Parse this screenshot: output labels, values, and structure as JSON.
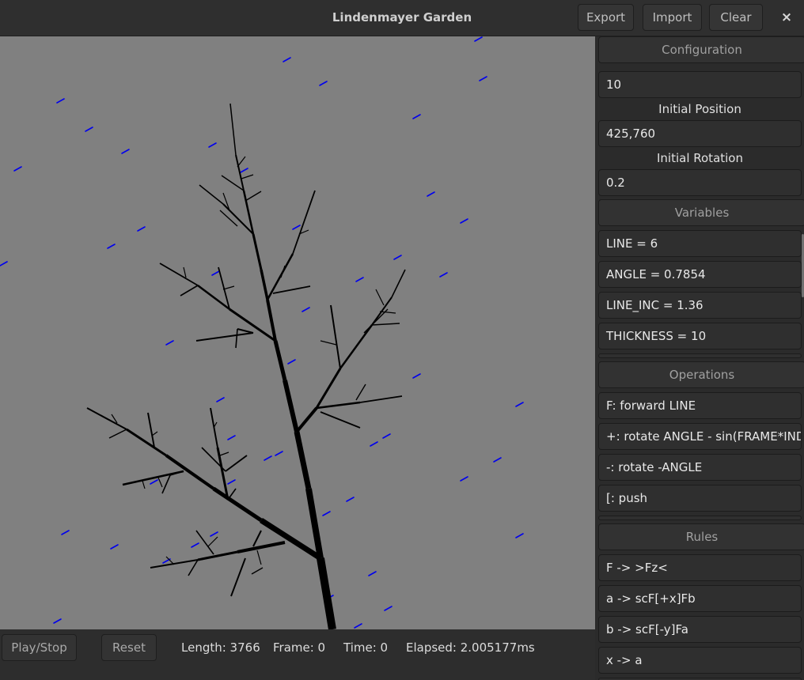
{
  "window": {
    "title": "Lindenmayer Garden",
    "buttons": {
      "export": "Export",
      "import": "Import",
      "clear": "Clear",
      "close": "×"
    }
  },
  "toolbar": {
    "play_stop": "Play/Stop",
    "reset": "Reset",
    "length": "Length: 3766",
    "frame": "Frame: 0",
    "time": "Time: 0",
    "elapsed": "Elapsed: 2.005177ms"
  },
  "panel": {
    "configuration": {
      "header": "Configuration",
      "iterations": "10",
      "initial_position_label": "Initial Position",
      "initial_position": "425,760",
      "initial_rotation_label": "Initial Rotation",
      "initial_rotation": "0.2"
    },
    "variables": {
      "header": "Variables",
      "items": [
        "LINE = 6",
        "ANGLE = 0.7854",
        "LINE_INC = 1.36",
        "THICKNESS = 10"
      ]
    },
    "operations": {
      "header": "Operations",
      "items": [
        "F: forward LINE",
        "+: rotate ANGLE - sin(FRAME*INDEX",
        "-: rotate -ANGLE",
        "[: push"
      ]
    },
    "rules": {
      "header": "Rules",
      "items": [
        "F -> >Fz<",
        "a -> scF[+x]Fb",
        "b -> scF[-y]Fa",
        "x -> a"
      ]
    }
  },
  "colors": {
    "canvas_bg": "#808080",
    "tree": "#000000",
    "rain": "#0000ee"
  }
}
